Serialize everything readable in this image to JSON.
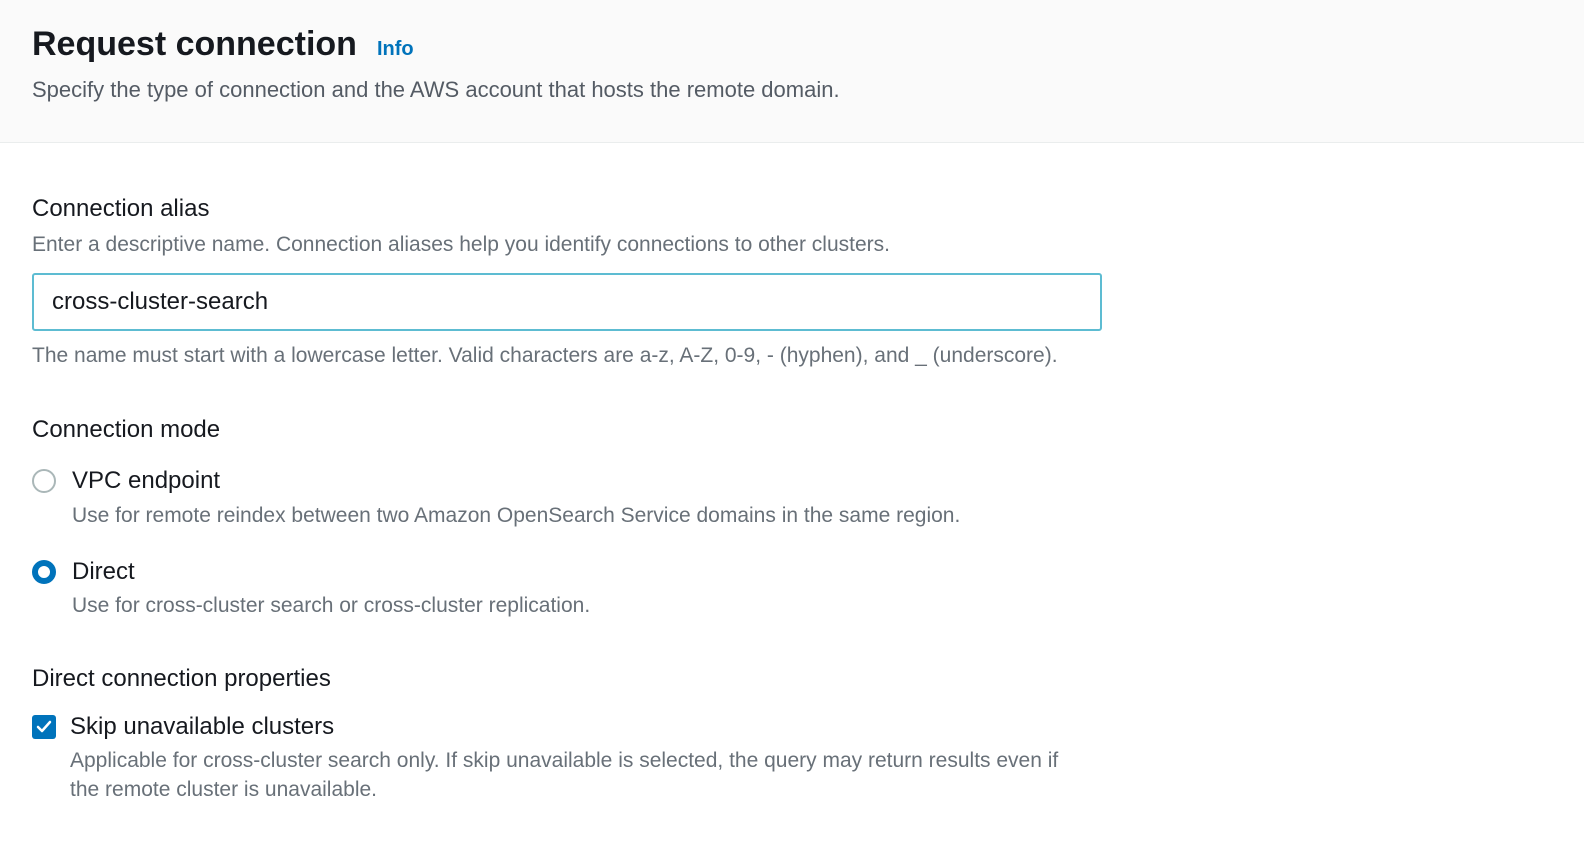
{
  "header": {
    "title": "Request connection",
    "info_link": "Info",
    "subtitle": "Specify the type of connection and the AWS account that hosts the remote domain."
  },
  "alias": {
    "label": "Connection alias",
    "description": "Enter a descriptive name. Connection aliases help you identify connections to other clusters.",
    "value": "cross-cluster-search",
    "hint": "The name must start with a lowercase letter. Valid characters are a-z, A-Z, 0-9, - (hyphen), and _ (underscore)."
  },
  "mode": {
    "label": "Connection mode",
    "options": [
      {
        "label": "VPC endpoint",
        "description": "Use for remote reindex between two Amazon OpenSearch Service domains in the same region.",
        "selected": false
      },
      {
        "label": "Direct",
        "description": "Use for cross-cluster search or cross-cluster replication.",
        "selected": true
      }
    ]
  },
  "direct_props": {
    "label": "Direct connection properties",
    "skip": {
      "label": "Skip unavailable clusters",
      "description": "Applicable for cross-cluster search only. If skip unavailable is selected, the query may return results even if the remote cluster is unavailable.",
      "checked": true
    }
  }
}
